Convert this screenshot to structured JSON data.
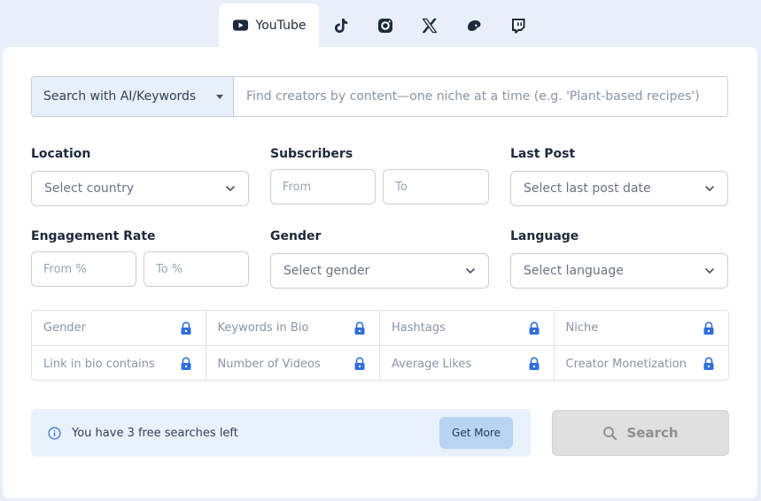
{
  "platform_tabs": [
    {
      "label": "YouTube",
      "icon": "youtube-icon",
      "active": true
    },
    {
      "icon": "tiktok-icon"
    },
    {
      "icon": "instagram-icon"
    },
    {
      "icon": "x-icon"
    },
    {
      "icon": "threads-icon"
    },
    {
      "icon": "twitch-icon"
    }
  ],
  "search": {
    "mode_label": "Search with AI/Keywords",
    "placeholder": "Find creators by content—one niche at a time (e.g. 'Plant-based recipes')",
    "value": ""
  },
  "filters": {
    "location": {
      "label": "Location",
      "placeholder": "Select country"
    },
    "subscribers": {
      "label": "Subscribers",
      "from_placeholder": "From",
      "to_placeholder": "To"
    },
    "last_post": {
      "label": "Last Post",
      "placeholder": "Select last post date"
    },
    "engagement_rate": {
      "label": "Engagement Rate",
      "from_placeholder": "From %",
      "to_placeholder": "To %"
    },
    "gender": {
      "label": "Gender",
      "placeholder": "Select gender"
    },
    "language": {
      "label": "Language",
      "placeholder": "Select language"
    }
  },
  "locked_filters": [
    "Gender",
    "Keywords in Bio",
    "Hashtags",
    "Niche",
    "Link in bio contains",
    "Number of Videos",
    "Average Likes",
    "Creator Monetization"
  ],
  "notice": {
    "text": "You have 3 free searches left",
    "button_label": "Get More"
  },
  "search_button": {
    "label": "Search",
    "enabled": false
  },
  "colors": {
    "page_bg": "#e8eff9",
    "accent_blue": "#2f6fdb",
    "mode_select_bg": "#e6effa",
    "notice_bg": "#e8f1fc",
    "get_more_bg": "#b9d3f3",
    "disabled_button_bg": "#e0e0e0"
  }
}
